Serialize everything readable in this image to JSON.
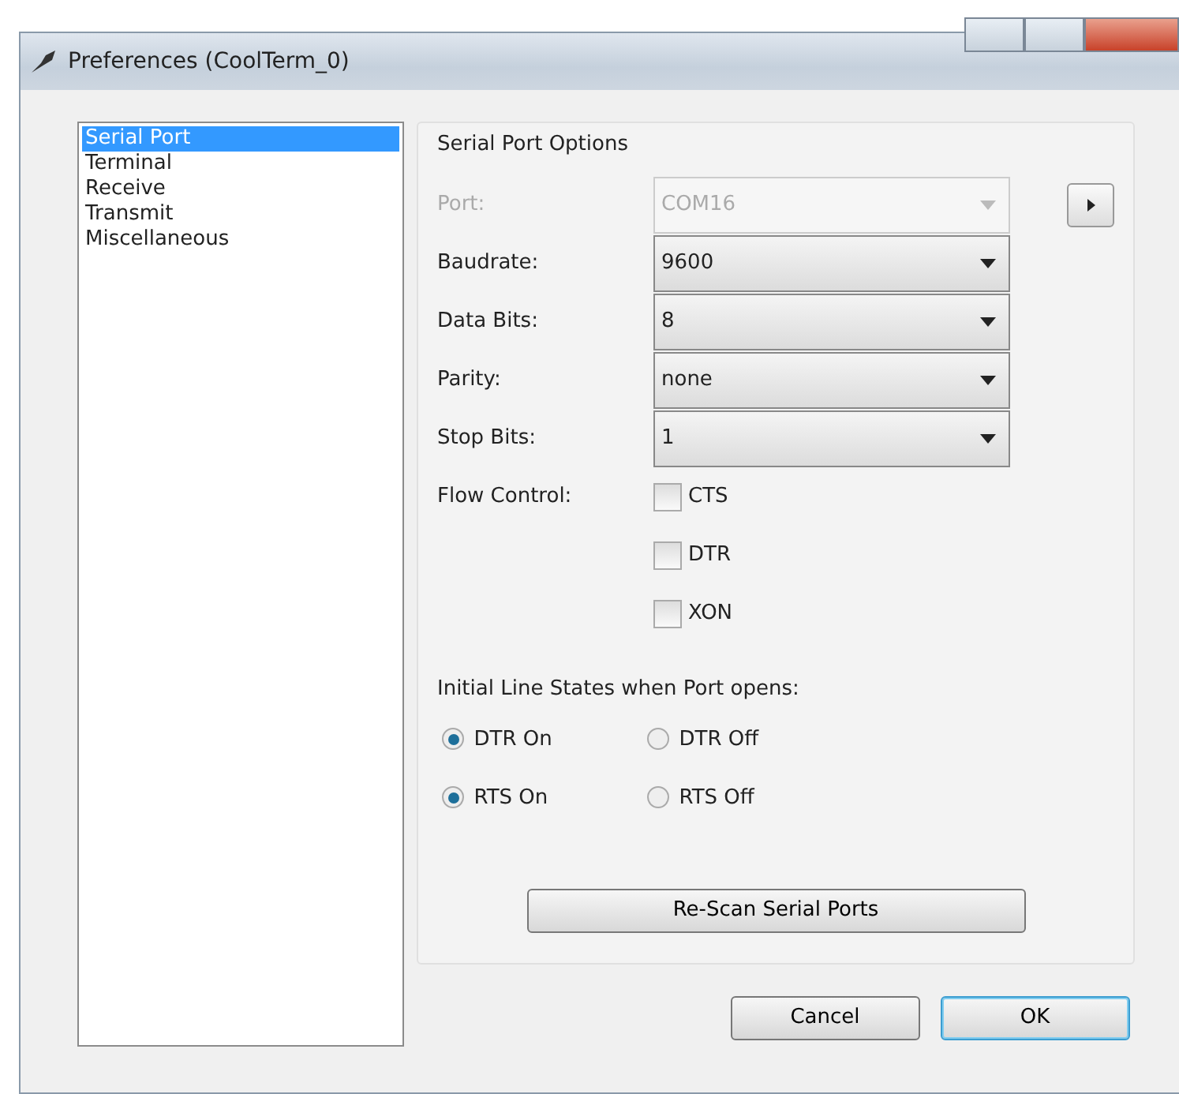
{
  "window": {
    "title": "Preferences (CoolTerm_0)"
  },
  "sidebar": {
    "items": [
      {
        "label": "Serial Port",
        "selected": true
      },
      {
        "label": "Terminal",
        "selected": false
      },
      {
        "label": "Receive",
        "selected": false
      },
      {
        "label": "Transmit",
        "selected": false
      },
      {
        "label": "Miscellaneous",
        "selected": false
      }
    ]
  },
  "group": {
    "title": "Serial Port Options",
    "fields": [
      {
        "label": "Port:",
        "value": "COM16",
        "disabled": true
      },
      {
        "label": "Baudrate:",
        "value": "9600",
        "disabled": false
      },
      {
        "label": "Data Bits:",
        "value": "8",
        "disabled": false
      },
      {
        "label": "Parity:",
        "value": "none",
        "disabled": false
      },
      {
        "label": "Stop Bits:",
        "value": "1",
        "disabled": false
      }
    ],
    "flow_control": {
      "label": "Flow Control:",
      "options": [
        {
          "label": "CTS",
          "checked": false
        },
        {
          "label": "DTR",
          "checked": false
        },
        {
          "label": "XON",
          "checked": false
        }
      ]
    },
    "line_states": {
      "title": "Initial Line States when Port opens:",
      "rows": [
        [
          {
            "label": "DTR On",
            "selected": true
          },
          {
            "label": "DTR Off",
            "selected": false
          }
        ],
        [
          {
            "label": "RTS On",
            "selected": true
          },
          {
            "label": "RTS Off",
            "selected": false
          }
        ]
      ]
    },
    "rescan_button": "Re-Scan Serial Ports"
  },
  "buttons": [
    {
      "label": "Cancel",
      "default": false
    },
    {
      "label": "OK",
      "default": true
    }
  ]
}
